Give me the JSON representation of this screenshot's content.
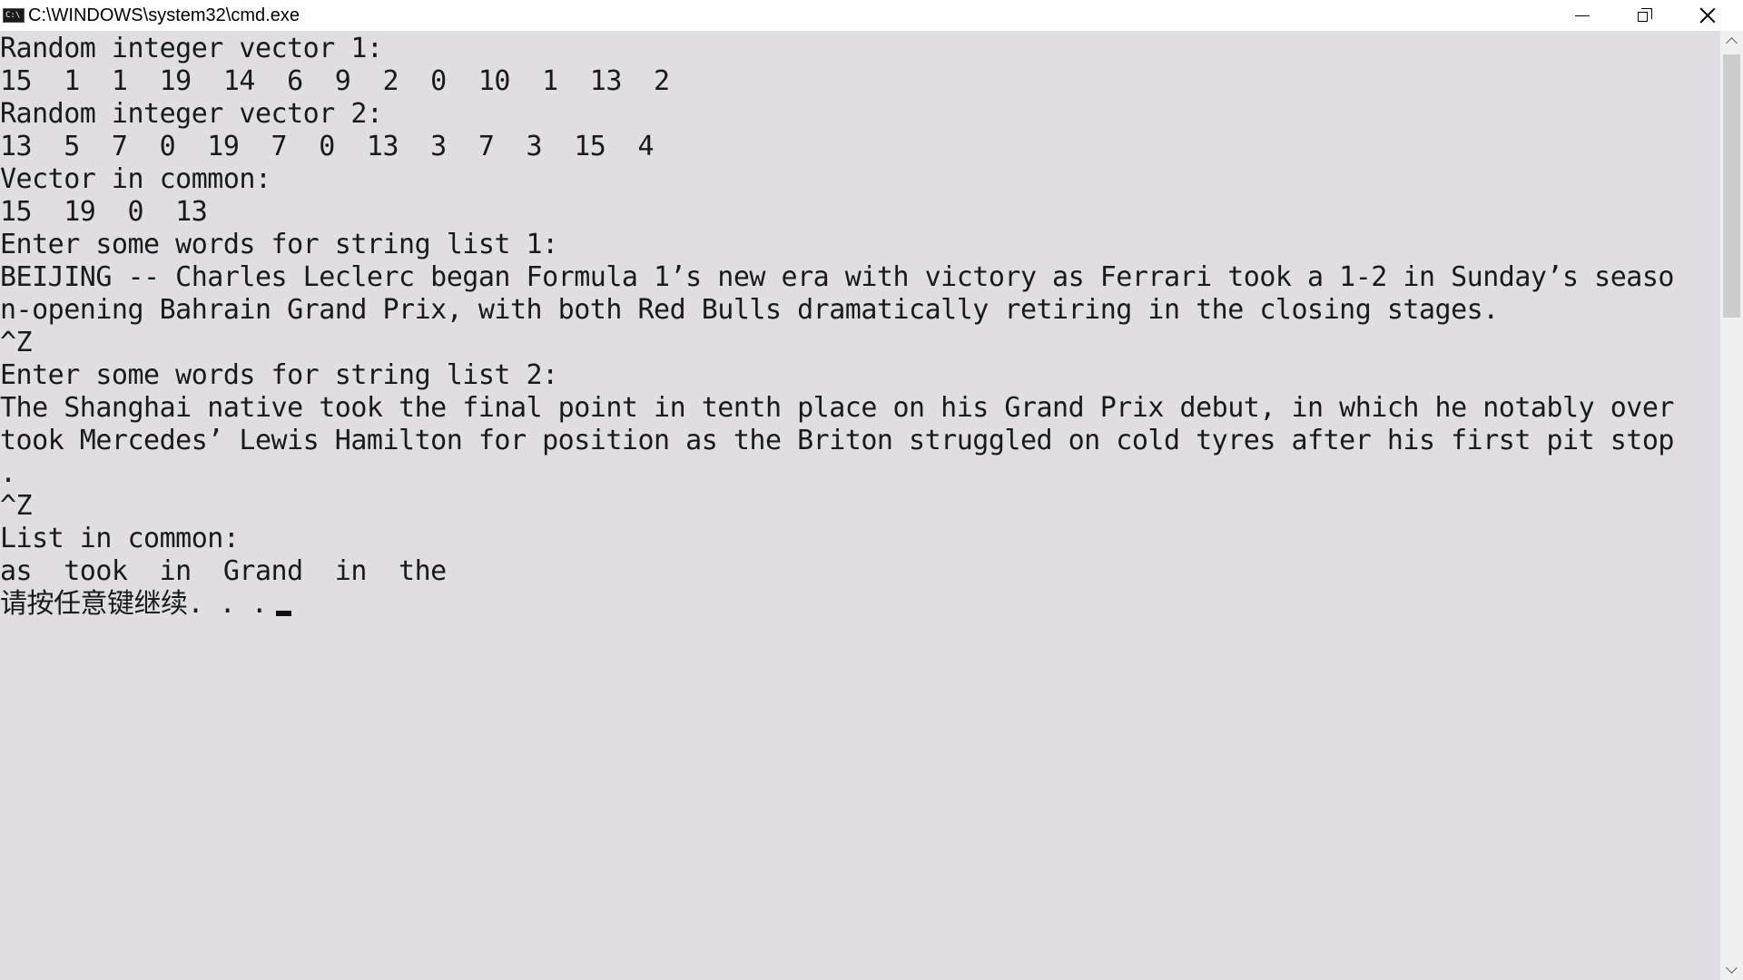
{
  "window": {
    "title": "C:\\WINDOWS\\system32\\cmd.exe",
    "icon": "cmd-icon",
    "icon_glyph": "C:\\"
  },
  "controls": {
    "minimize_icon": "minimize-icon",
    "restore_icon": "restore-icon",
    "close_icon": "close-icon"
  },
  "console": {
    "background": "#e0dee2",
    "foreground": "#1a1a1a",
    "lines": [
      "Random integer vector 1:",
      "15  1  1  19  14  6  9  2  0  10  1  13  2",
      "Random integer vector 2:",
      "13  5  7  0  19  7  0  13  3  7  3  15  4",
      "Vector in common:",
      "15  19  0  13",
      "Enter some words for string list 1:",
      "BEIJING -- Charles Leclerc began Formula 1’s new era with victory as Ferrari took a 1-2 in Sunday’s seaso",
      "n-opening Bahrain Grand Prix, with both Red Bulls dramatically retiring in the closing stages.",
      "^Z",
      "Enter some words for string list 2:",
      "The Shanghai native took the final point in tenth place on his Grand Prix debut, in which he notably over",
      "took Mercedes’ Lewis Hamilton for position as the Briton struggled on cold tyres after his first pit stop",
      ".",
      "^Z",
      "List in common:",
      "as  took  in  Grand  in  the",
      "请按任意键继续. . ."
    ]
  },
  "scrollbar": {
    "up_icon": "scroll-up-arrow-icon",
    "down_icon": "scroll-down-arrow-icon"
  }
}
